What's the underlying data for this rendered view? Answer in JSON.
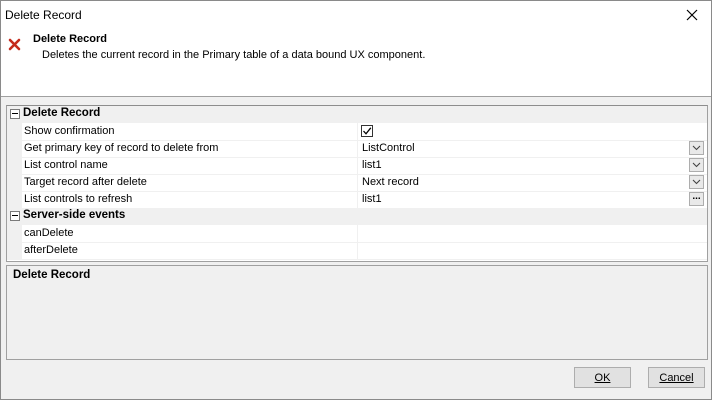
{
  "window": {
    "title": "Delete Record",
    "close_icon": "close-icon"
  },
  "header": {
    "title": "Delete Record",
    "description": "Deletes the current record in the Primary table of a data bound UX component.",
    "icon": "red-x-icon"
  },
  "grid": {
    "categories": [
      {
        "label": "Delete Record",
        "properties": [
          {
            "name": "Show confirmation",
            "value": "",
            "checked": true
          },
          {
            "name": "Get primary key of record to delete from",
            "value": "ListControl"
          },
          {
            "name": "List control name",
            "value": "list1"
          },
          {
            "name": "Target record after delete",
            "value": "Next record"
          },
          {
            "name": "List controls to refresh",
            "value": "list1",
            "button": "..."
          }
        ]
      },
      {
        "label": "Server-side events",
        "properties": [
          {
            "name": "canDelete",
            "value": ""
          },
          {
            "name": "afterDelete",
            "value": ""
          }
        ]
      }
    ]
  },
  "description_panel": {
    "title": "Delete Record"
  },
  "buttons": {
    "ok": {
      "label": "OK",
      "mnemonic": "O"
    },
    "cancel": {
      "label": "Cancel",
      "mnemonic": "C"
    }
  },
  "colors": {
    "accent_red": "#c42b1c",
    "panel_bg": "#f0f0f0",
    "border": "#a0a0a0"
  }
}
